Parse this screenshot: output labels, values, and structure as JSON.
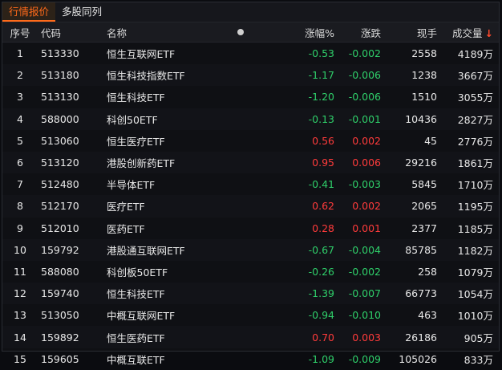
{
  "tabs": [
    "行情报价",
    "多股同列"
  ],
  "columns": {
    "idx": "序号",
    "code": "代码",
    "name": "名称",
    "pct": "涨幅%",
    "chg": "涨跌",
    "hands": "现手",
    "vol": "成交量",
    "sort_arrow": "↓"
  },
  "colors": {
    "up": "#ff3b3b",
    "down": "#2fcf6a",
    "accent": "#ff6a1a"
  },
  "rows": [
    {
      "idx": "1",
      "code": "513330",
      "name": "恒生互联网ETF",
      "pct": "-0.53",
      "chg": "-0.002",
      "hands": "2558",
      "vol": "4189万",
      "dir": "down"
    },
    {
      "idx": "2",
      "code": "513180",
      "name": "恒生科技指数ETF",
      "pct": "-1.17",
      "chg": "-0.006",
      "hands": "1238",
      "vol": "3667万",
      "dir": "down"
    },
    {
      "idx": "3",
      "code": "513130",
      "name": "恒生科技ETF",
      "pct": "-1.20",
      "chg": "-0.006",
      "hands": "1510",
      "vol": "3055万",
      "dir": "down"
    },
    {
      "idx": "4",
      "code": "588000",
      "name": "科创50ETF",
      "pct": "-0.13",
      "chg": "-0.001",
      "hands": "10436",
      "vol": "2827万",
      "dir": "down"
    },
    {
      "idx": "5",
      "code": "513060",
      "name": "恒生医疗ETF",
      "pct": "0.56",
      "chg": "0.002",
      "hands": "45",
      "vol": "2776万",
      "dir": "up"
    },
    {
      "idx": "6",
      "code": "513120",
      "name": "港股创新药ETF",
      "pct": "0.95",
      "chg": "0.006",
      "hands": "29216",
      "vol": "1861万",
      "dir": "up"
    },
    {
      "idx": "7",
      "code": "512480",
      "name": "半导体ETF",
      "pct": "-0.41",
      "chg": "-0.003",
      "hands": "5845",
      "vol": "1710万",
      "dir": "down"
    },
    {
      "idx": "8",
      "code": "512170",
      "name": "医疗ETF",
      "pct": "0.62",
      "chg": "0.002",
      "hands": "2065",
      "vol": "1195万",
      "dir": "up"
    },
    {
      "idx": "9",
      "code": "512010",
      "name": "医药ETF",
      "pct": "0.28",
      "chg": "0.001",
      "hands": "2377",
      "vol": "1185万",
      "dir": "up"
    },
    {
      "idx": "10",
      "code": "159792",
      "name": "港股通互联网ETF",
      "pct": "-0.67",
      "chg": "-0.004",
      "hands": "85785",
      "vol": "1182万",
      "dir": "down"
    },
    {
      "idx": "11",
      "code": "588080",
      "name": "科创板50ETF",
      "pct": "-0.26",
      "chg": "-0.002",
      "hands": "258",
      "vol": "1079万",
      "dir": "down"
    },
    {
      "idx": "12",
      "code": "159740",
      "name": "恒生科技ETF",
      "pct": "-1.39",
      "chg": "-0.007",
      "hands": "66773",
      "vol": "1054万",
      "dir": "down"
    },
    {
      "idx": "13",
      "code": "513050",
      "name": "中概互联网ETF",
      "pct": "-0.94",
      "chg": "-0.010",
      "hands": "463",
      "vol": "1010万",
      "dir": "down"
    },
    {
      "idx": "14",
      "code": "159892",
      "name": "恒生医药ETF",
      "pct": "0.70",
      "chg": "0.003",
      "hands": "26186",
      "vol": "905万",
      "dir": "up"
    },
    {
      "idx": "15",
      "code": "159605",
      "name": "中概互联ETF",
      "pct": "-1.09",
      "chg": "-0.009",
      "hands": "105026",
      "vol": "833万",
      "dir": "down"
    }
  ]
}
